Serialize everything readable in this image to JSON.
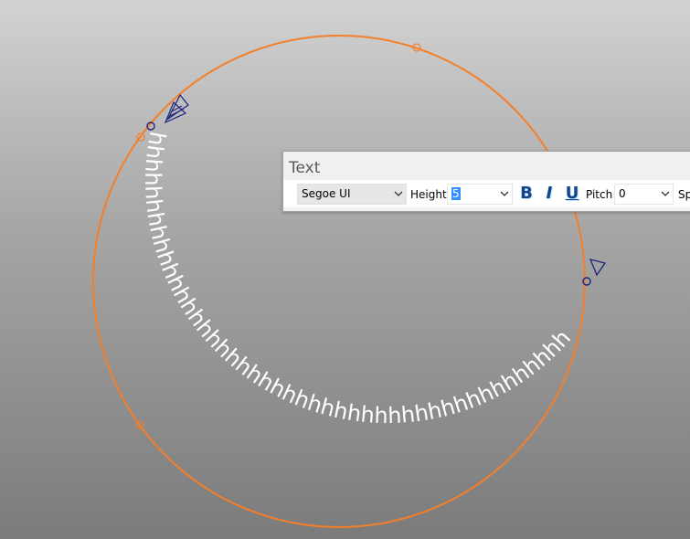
{
  "arc_text": {
    "content": "hhhhhhhhhhhhhhhhhhhhhhhhhhhhhhhhhhhhhhhhhhhhhhhhhhhhhhhhhhhhhhhhhhhhhhhhhhhhhhhhhhhhhh",
    "text_color": "#ffffff",
    "circle_color": "#f57f28",
    "grip_color": "#1a237e"
  },
  "text_panel": {
    "title": "Text",
    "font": "Segoe UI",
    "height_label": "Height",
    "height_value": "5",
    "bold_label": "B",
    "italic_label": "I",
    "underline_label": "U",
    "pitch_label": "Pitch",
    "pitch_value": "0",
    "spacing_label": "Sp"
  }
}
